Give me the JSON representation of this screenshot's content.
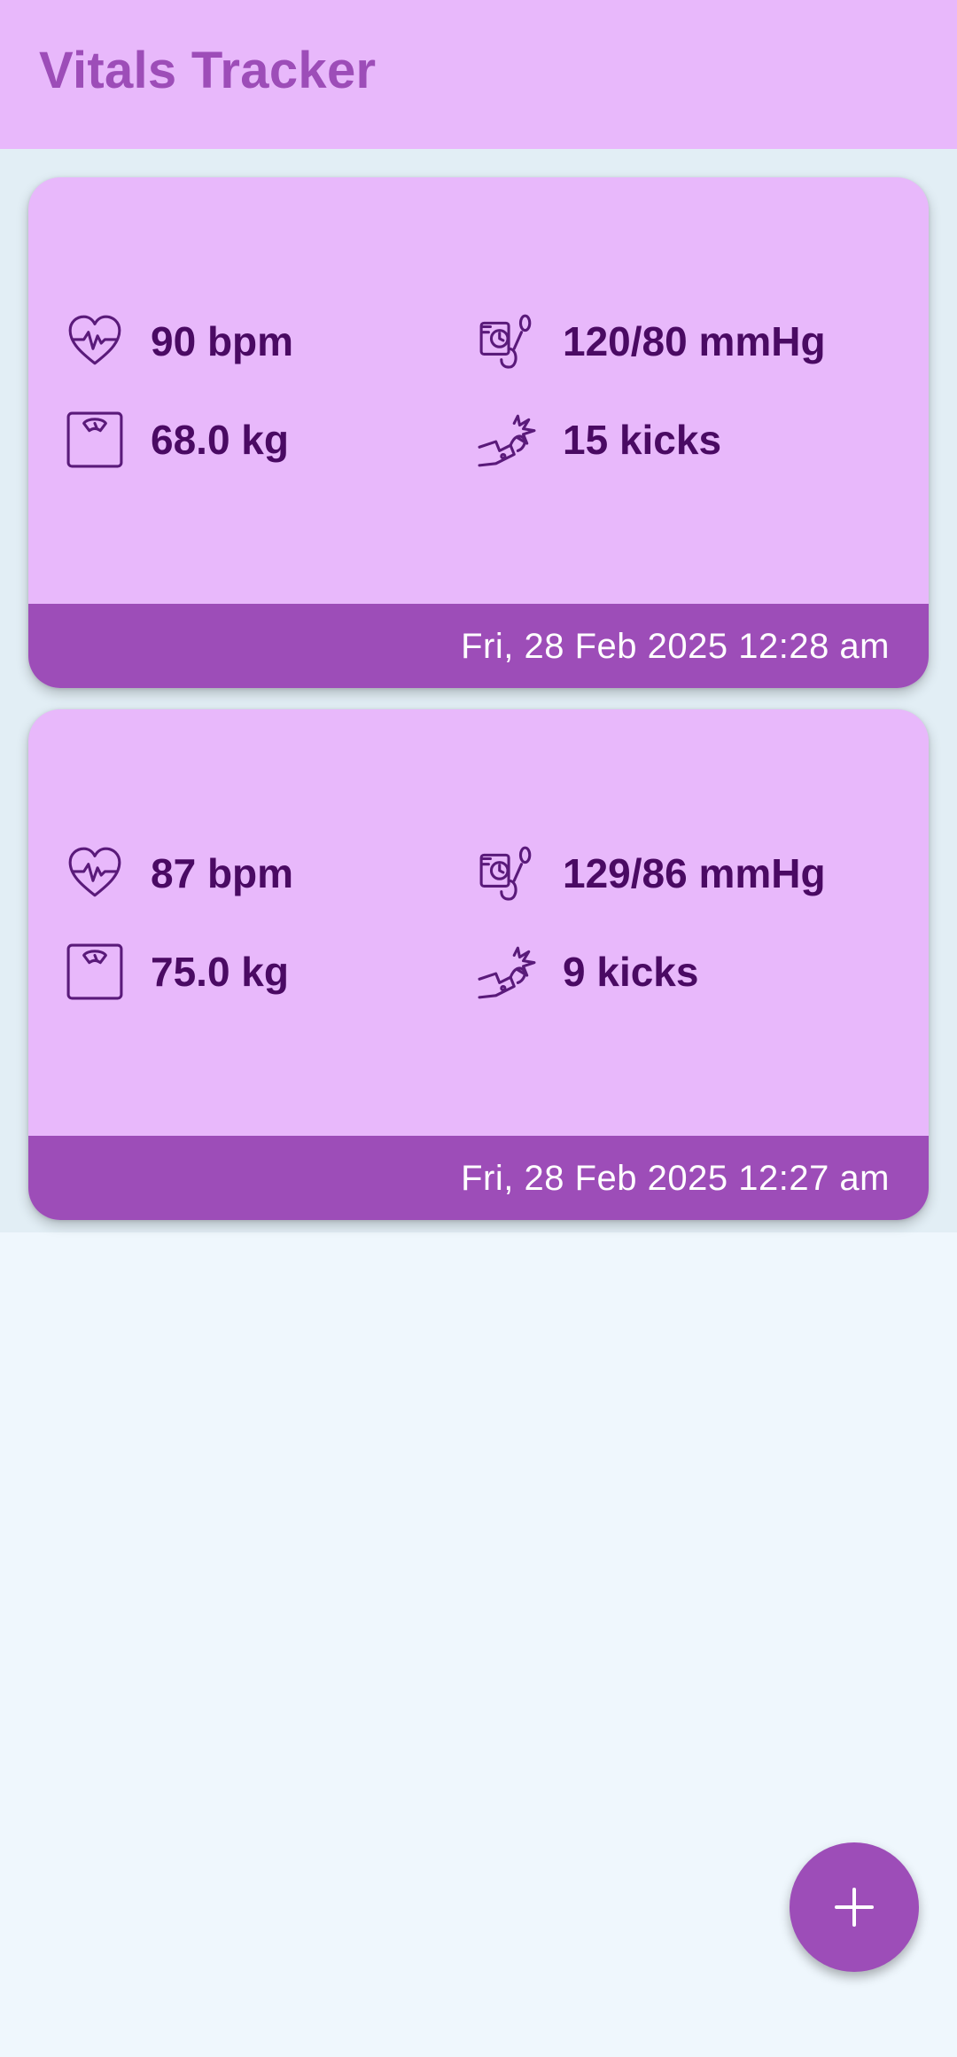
{
  "app": {
    "title": "Vitals Tracker"
  },
  "entries": [
    {
      "heart_rate": "90 bpm",
      "blood_pressure": "120/80 mmHg",
      "weight": "68.0 kg",
      "kicks": "15 kicks",
      "timestamp": "Fri, 28 Feb 2025 12:28 am"
    },
    {
      "heart_rate": "87 bpm",
      "blood_pressure": "129/86 mmHg",
      "weight": "75.0 kg",
      "kicks": "9 kicks",
      "timestamp": "Fri, 28 Feb 2025 12:27 am"
    }
  ],
  "icons": {
    "heart_rate": "heart-pulse-icon",
    "blood_pressure": "blood-pressure-monitor-icon",
    "weight": "weighing-scale-icon",
    "kicks": "baby-kick-icon",
    "fab": "plus-icon"
  },
  "colors": {
    "app_bar": "#e8b8fb",
    "title": "#9d4db8",
    "card": "#e8b8fb",
    "card_footer": "#9d4db8",
    "value_text": "#4a0a63",
    "fab": "#9d4db8",
    "background": "#eff7fd"
  }
}
